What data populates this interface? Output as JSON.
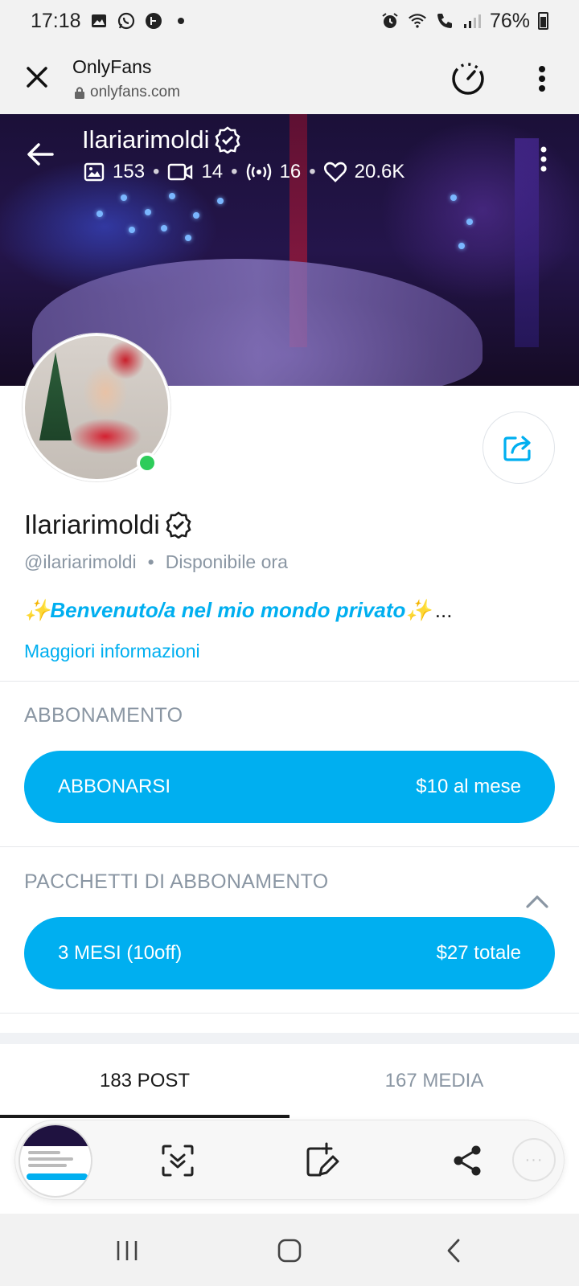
{
  "status_bar": {
    "time": "17:18",
    "battery": "76%",
    "icons_left": [
      "gallery-icon",
      "whatsapp-icon",
      "app-icon",
      "dot-icon"
    ],
    "icons_right": [
      "alarm-icon",
      "wifi-icon",
      "call-icon",
      "signal-icon",
      "battery-icon"
    ]
  },
  "browser": {
    "title": "OnlyFans",
    "url": "onlyfans.com"
  },
  "cover": {
    "name": "Ilariarimoldi",
    "stats": {
      "photos": "153",
      "videos": "14",
      "streams": "16",
      "likes": "20.6K"
    },
    "separator": "•"
  },
  "profile": {
    "name": "Ilariarimoldi",
    "handle": "@ilariarimoldi",
    "separator": "•",
    "availability": "Disponibile ora",
    "bio_sparkle_left": "✨",
    "bio": "Benvenuto/a nel mio mondo privato",
    "bio_sparkle_right": "✨",
    "bio_ellipsis": "...",
    "more_info": "Maggiori informazioni",
    "online": true
  },
  "subscription": {
    "title": "ABBONAMENTO",
    "button_label": "ABBONARSI",
    "button_price": "$10 al mese"
  },
  "bundles": {
    "title": "PACCHETTI DI ABBONAMENTO",
    "expanded": true,
    "items": [
      {
        "label": "3 MESI (10off)",
        "price": "$27 totale"
      }
    ]
  },
  "tabs": [
    {
      "label": "183 POST",
      "active": true
    },
    {
      "label": "167 MEDIA",
      "active": false
    }
  ],
  "screenshot_toolbar": {
    "tools": [
      "scroll-capture-icon",
      "edit-icon",
      "share-icon"
    ],
    "more": "···"
  },
  "colors": {
    "accent": "#00aff0",
    "online": "#2ecc5a",
    "muted": "#8a96a3"
  }
}
